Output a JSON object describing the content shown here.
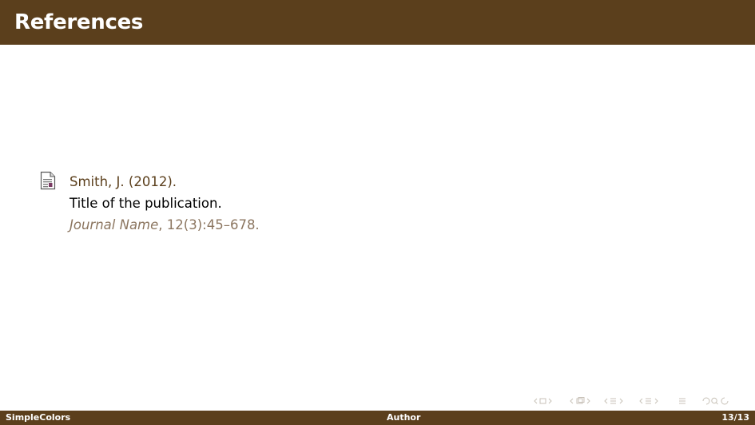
{
  "slide": {
    "title": "References"
  },
  "bibliography": {
    "entries": [
      {
        "icon": "article-icon",
        "author_year": "Smith, J. (2012).",
        "title": "Title of the publication.",
        "journal": "Journal Name",
        "details": ", 12(3):45–678."
      }
    ]
  },
  "footer": {
    "left": "SimpleColors",
    "center": "Author",
    "right": "13/13"
  },
  "colors": {
    "theme": "#5b3f1c",
    "muted_text": "#8c7660",
    "nav_icons": "#c8c2b8"
  }
}
